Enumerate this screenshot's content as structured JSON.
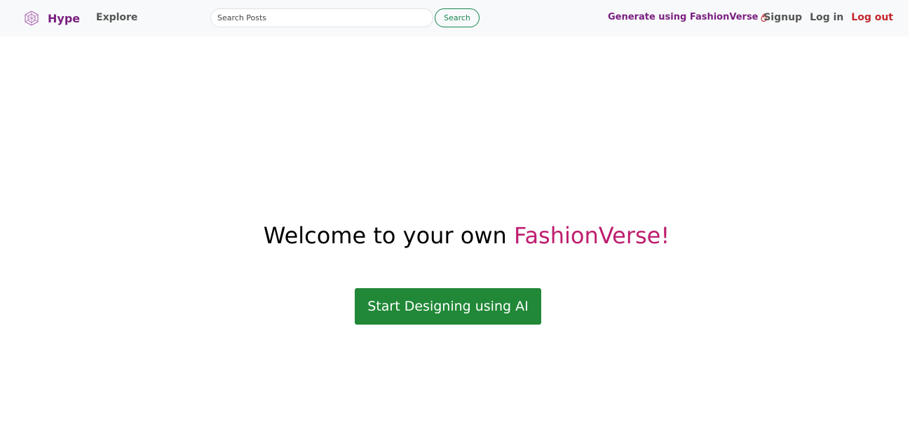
{
  "navbar": {
    "brand": {
      "label": "Hype",
      "icon": "hexagon-logo-icon",
      "color": "#7a1f80"
    },
    "explore_label": "Explore",
    "search": {
      "placeholder": "Search Posts",
      "value": "",
      "button_label": "Search"
    },
    "generate_label": "Generate using FashionVerse",
    "generate_icon": "flame-icon",
    "signup_label": "Signup",
    "login_label": "Log in",
    "logout_label": "Log out"
  },
  "hero": {
    "title_prefix": "Welcome to your own ",
    "title_accent": "FashionVerse!",
    "cta_label": "Start Designing using AI"
  },
  "colors": {
    "brand_purple": "#7a1f80",
    "accent_magenta": "#be1d6f",
    "success_green": "#218838",
    "logout_red": "#c2272d",
    "navbar_bg": "#f8f9fa"
  }
}
